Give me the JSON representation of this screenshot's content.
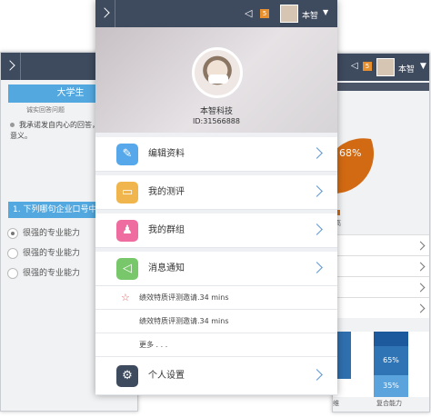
{
  "back_screen": {
    "title_visible": "大学生",
    "note": "诚实回答问题",
    "intro": "我承诺发自内心的回答，对我也没有意义。",
    "question_title": "1. 下列哪句企业口号中",
    "options": [
      "很强的专业能力",
      "很强的专业能力",
      "很强的专业能力"
    ]
  },
  "right_screen": {
    "user_name": "本智",
    "notification_count": "5",
    "pie_percent": "68%",
    "legend_text": "高",
    "bars": [
      {
        "label": "",
        "values": []
      },
      {
        "label": "复合能力",
        "values": [
          "65%",
          "35%"
        ]
      }
    ],
    "partial_label": "维"
  },
  "front_screen": {
    "user_name": "本智",
    "notification_count": "5",
    "company_name": "本智科技",
    "user_id": "ID:31566888",
    "menu_items": [
      {
        "label": "编辑资料",
        "icon": "edit-icon",
        "color": "#56a8ea"
      },
      {
        "label": "我的测评",
        "icon": "folder-icon",
        "color": "#f0b64d"
      },
      {
        "label": "我的群组",
        "icon": "people-icon",
        "color": "#ee6c9f"
      },
      {
        "label": "消息通知",
        "icon": "speaker-icon",
        "color": "#78c76a"
      }
    ],
    "notifications": [
      "绩效特质评测邀请.34 mins",
      "绩效特质评测邀请.34 mins"
    ],
    "more": "更多 . . .",
    "settings": {
      "label": "个人设置",
      "icon": "gear-icon",
      "color": "#3e4a5e"
    }
  }
}
